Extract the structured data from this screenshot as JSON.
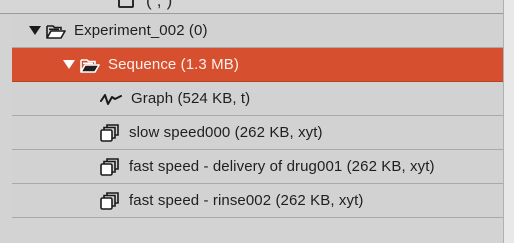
{
  "tree": {
    "top_partial": {
      "label": "(   ,     )"
    },
    "rows": [
      {
        "label": "Experiment_002 (0)",
        "icon": "open-folder-icon",
        "expanded": true
      },
      {
        "label": "Sequence (1.3 MB)",
        "icon": "open-folder-icon",
        "expanded": true,
        "selected": true
      },
      {
        "label": "Graph (524 KB, t)",
        "icon": "graph-icon"
      },
      {
        "label": "slow speed000 (262 KB, xyt)",
        "icon": "image-stack-icon"
      },
      {
        "label": "fast speed - delivery of drug001 (262 KB, xyt)",
        "icon": "image-stack-icon"
      },
      {
        "label": "fast speed - rinse002 (262 KB, xyt)",
        "icon": "image-stack-icon"
      }
    ]
  },
  "colors": {
    "selection": "#d6502f",
    "row_background": "#d2d2d2",
    "separator": "#a9a9a9"
  }
}
